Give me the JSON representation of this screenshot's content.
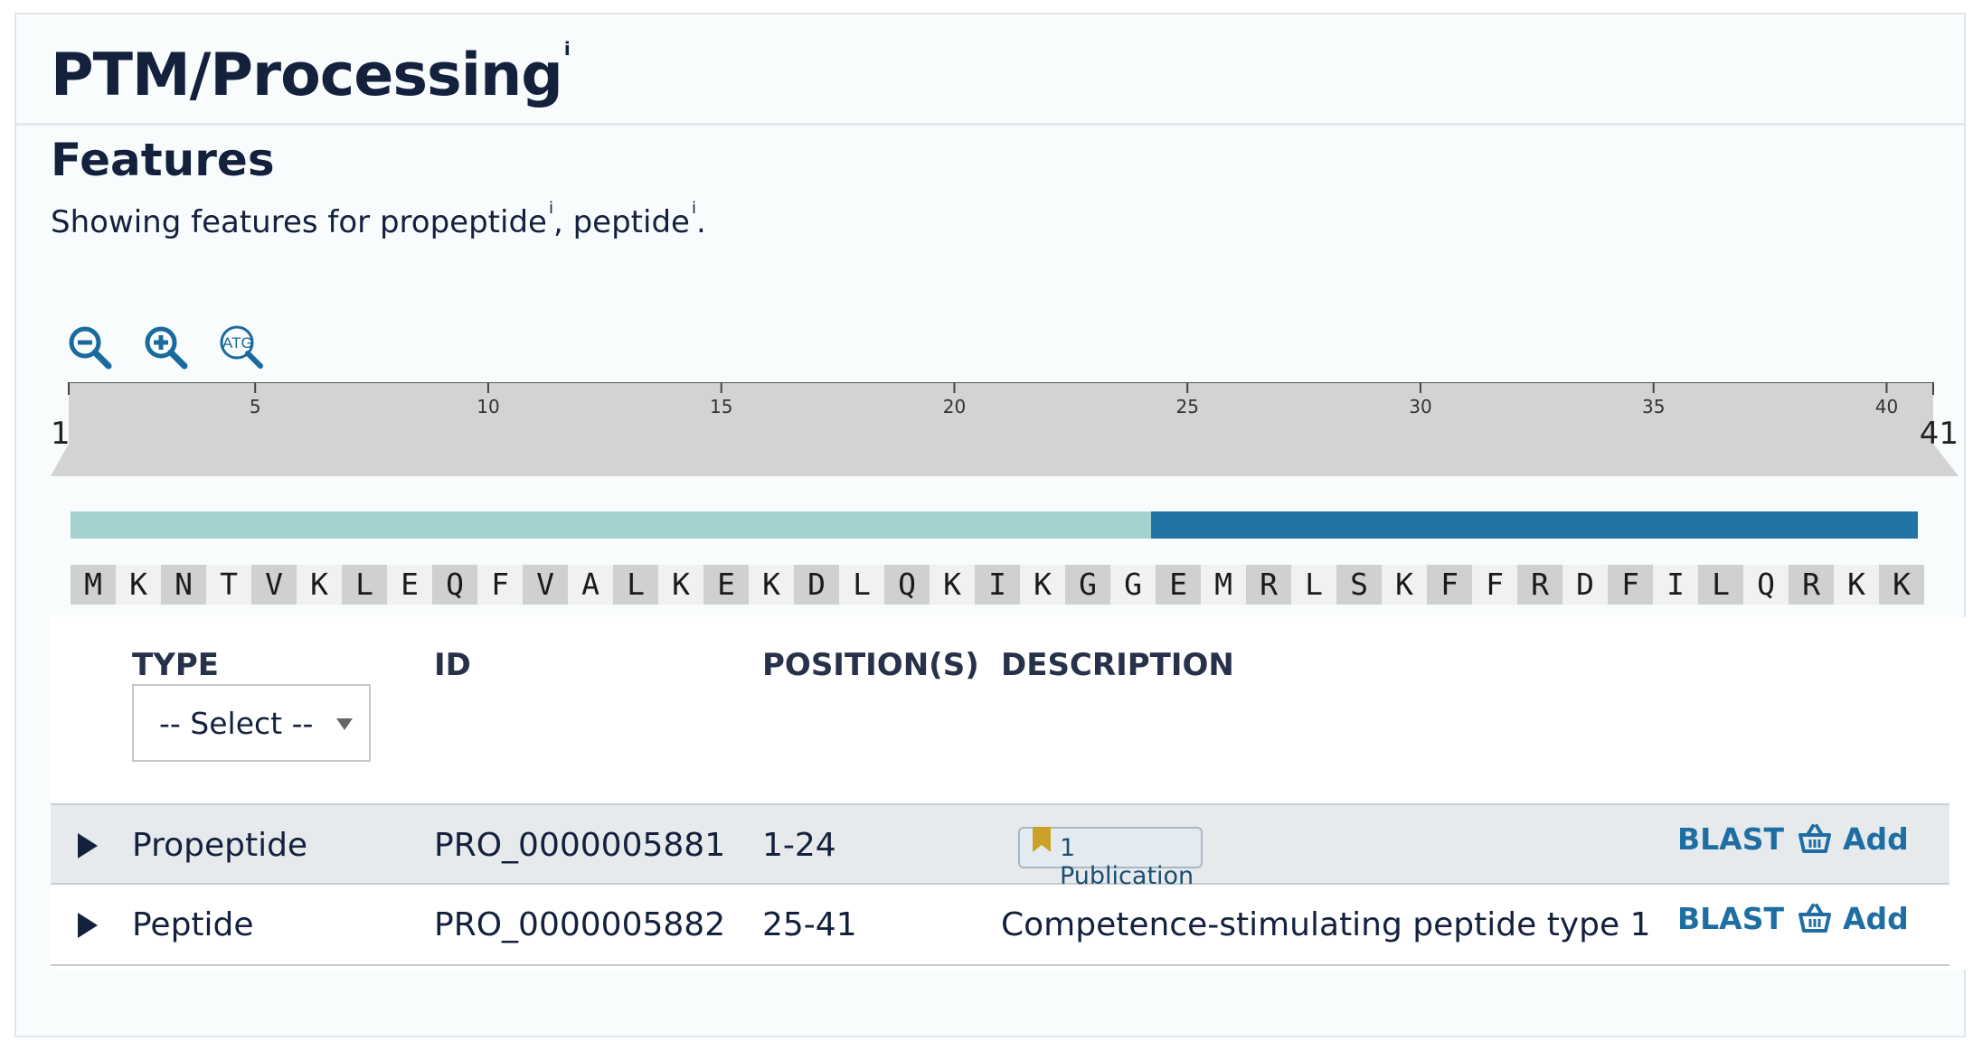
{
  "section": {
    "title": "PTM/Processing",
    "title_info": "i"
  },
  "features": {
    "title": "Features",
    "showing_prefix": "Showing features for ",
    "term1": "propeptide",
    "term1_info": "i",
    "separator": ", ",
    "term2": "peptide",
    "term2_info": "i",
    "suffix": "."
  },
  "toolbar": {
    "zoom_out": "zoom-out-icon",
    "zoom_in": "zoom-in-icon",
    "sequence_icon_label": "ATG"
  },
  "ruler": {
    "start_label": "1",
    "end_label": "41",
    "ticks": [
      "5",
      "10",
      "15",
      "20",
      "25",
      "30",
      "35",
      "40"
    ]
  },
  "track": {
    "propeptide_range": [
      1,
      24
    ],
    "peptide_range": [
      25,
      41
    ],
    "colors": {
      "propeptide": "#a3d1d0",
      "peptide": "#2274a5"
    }
  },
  "sequence": [
    "M",
    "K",
    "N",
    "T",
    "V",
    "K",
    "L",
    "E",
    "Q",
    "F",
    "V",
    "A",
    "L",
    "K",
    "E",
    "K",
    "D",
    "L",
    "Q",
    "K",
    "I",
    "K",
    "G",
    "G",
    "E",
    "M",
    "R",
    "L",
    "S",
    "K",
    "F",
    "F",
    "R",
    "D",
    "F",
    "I",
    "L",
    "Q",
    "R",
    "K",
    "K"
  ],
  "table": {
    "headers": {
      "type": "TYPE",
      "id": "ID",
      "positions": "POSITION(S)",
      "description": "DESCRIPTION"
    },
    "type_filter": "-- Select --",
    "rows": [
      {
        "type": "Propeptide",
        "id": "PRO_0000005881",
        "positions": "1-24",
        "description": "",
        "publication": "1 Publication",
        "blast": "BLAST",
        "add": "Add"
      },
      {
        "type": "Peptide",
        "id": "PRO_0000005882",
        "positions": "25-41",
        "description": "Competence-stimulating peptide type 1",
        "publication": "",
        "blast": "BLAST",
        "add": "Add"
      }
    ]
  }
}
